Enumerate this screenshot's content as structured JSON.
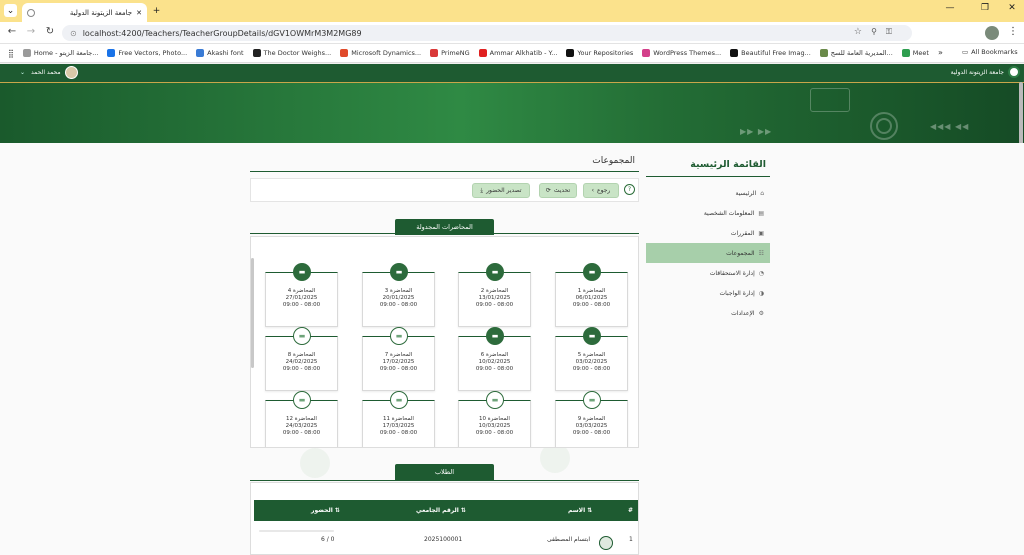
{
  "browser": {
    "tab_title": "جامعة الزيتونة الدولية",
    "url": "localhost:4200/Teachers/TeacherGroupDetails/dGV1OWMrM3M2MG89",
    "bookmarks": [
      {
        "label": "Home - جامعة الزيتو...",
        "color": "#9a9a9a"
      },
      {
        "label": "Free Vectors, Photo...",
        "color": "#1a73e8"
      },
      {
        "label": "Akashi font",
        "color": "#3a7bd5"
      },
      {
        "label": "The Doctor Weighs...",
        "color": "#222222"
      },
      {
        "label": "Microsoft Dynamics...",
        "color": "#e04a2a"
      },
      {
        "label": "PrimeNG",
        "color": "#d93838"
      },
      {
        "label": "Ammar Alkhatib - Y...",
        "color": "#e02020"
      },
      {
        "label": "Your Repositories",
        "color": "#111111"
      },
      {
        "label": "WordPress Themes...",
        "color": "#d33f8a"
      },
      {
        "label": "Beautiful Free Imag...",
        "color": "#111111"
      },
      {
        "label": "المديرية العامة للسج...",
        "color": "#6a8a4a"
      },
      {
        "label": "Meet",
        "color": "#2e9e4f"
      }
    ],
    "all_bookmarks": "All Bookmarks"
  },
  "app": {
    "user_name": "محمد الحمد",
    "university": "جامعة الزيتونة الدولية"
  },
  "sidebar": {
    "title": "القائمة الرئيسية",
    "items": [
      {
        "label": "الرئيسية",
        "icon": "⌂",
        "active": false
      },
      {
        "label": "المعلومات الشخصية",
        "icon": "▤",
        "active": false
      },
      {
        "label": "المقررات",
        "icon": "▣",
        "active": false
      },
      {
        "label": "المجموعات",
        "icon": "☷",
        "active": true
      },
      {
        "label": "إدارة الاستحقاقات",
        "icon": "◔",
        "active": false
      },
      {
        "label": "إدارة الواجبات",
        "icon": "◑",
        "active": false
      },
      {
        "label": "الإعدادات",
        "icon": "⚙",
        "active": false
      }
    ]
  },
  "main": {
    "title": "المجموعات",
    "buttons": {
      "back": "رجوع",
      "refresh": "تحديث",
      "export": "تصدير الحضور"
    },
    "lectures_header": "المحاضرات المجدولة",
    "lectures": [
      {
        "name": "المحاضرة 1",
        "date": "06/01/2025",
        "time": "09:00 - 08:00",
        "filled": true
      },
      {
        "name": "المحاضرة 2",
        "date": "13/01/2025",
        "time": "09:00 - 08:00",
        "filled": true
      },
      {
        "name": "المحاضرة 3",
        "date": "20/01/2025",
        "time": "09:00 - 08:00",
        "filled": true
      },
      {
        "name": "المحاضرة 4",
        "date": "27/01/2025",
        "time": "09:00 - 08:00",
        "filled": true
      },
      {
        "name": "المحاضرة 5",
        "date": "03/02/2025",
        "time": "09:00 - 08:00",
        "filled": true
      },
      {
        "name": "المحاضرة 6",
        "date": "10/02/2025",
        "time": "09:00 - 08:00",
        "filled": true
      },
      {
        "name": "المحاضرة 7",
        "date": "17/02/2025",
        "time": "09:00 - 08:00",
        "filled": false
      },
      {
        "name": "المحاضرة 8",
        "date": "24/02/2025",
        "time": "09:00 - 08:00",
        "filled": false
      },
      {
        "name": "المحاضرة 9",
        "date": "03/03/2025",
        "time": "09:00 - 08:00",
        "filled": false
      },
      {
        "name": "المحاضرة 10",
        "date": "10/03/2025",
        "time": "09:00 - 08:00",
        "filled": false
      },
      {
        "name": "المحاضرة 11",
        "date": "17/03/2025",
        "time": "09:00 - 08:00",
        "filled": false
      },
      {
        "name": "المحاضرة 12",
        "date": "24/03/2025",
        "time": "09:00 - 08:00",
        "filled": false
      }
    ],
    "students_header": "الطلاب",
    "table": {
      "col_num": "#",
      "col_name": "الاسم ⇅",
      "col_id": "الرقم الجامعي ⇅",
      "col_attend": "الحضور ⇅",
      "rows": [
        {
          "num": "1",
          "name": "ابتسام المصطفى",
          "id": "2025100001",
          "attendance": "6 / 0",
          "progress": 0
        }
      ]
    }
  }
}
